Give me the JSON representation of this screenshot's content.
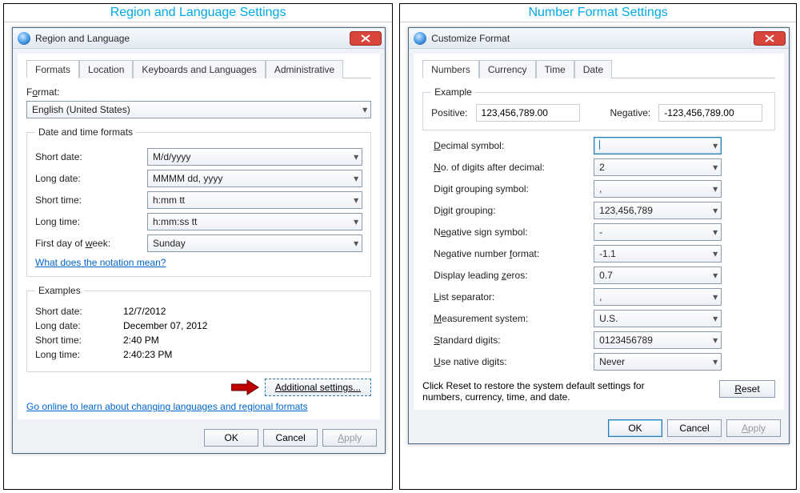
{
  "left": {
    "panel_title": "Region and Language Settings",
    "win_title": "Region and Language",
    "tabs": [
      "Formats",
      "Location",
      "Keyboards and Languages",
      "Administrative"
    ],
    "active_tab": 0,
    "format_label_pre": "F",
    "format_label_u": "o",
    "format_label_post": "rmat:",
    "format_value": "English (United States)",
    "group_dt_title": "Date and time formats",
    "rows": [
      {
        "label": "Short date:",
        "value": "M/d/yyyy"
      },
      {
        "label": "Long date:",
        "value": "MMMM dd, yyyy"
      },
      {
        "label": "Short time:",
        "value": "h:mm tt"
      },
      {
        "label": "Long time:",
        "value": "h:mm:ss tt"
      }
    ],
    "firstday_label_pre": "First day of ",
    "firstday_label_u": "w",
    "firstday_label_post": "eek:",
    "firstday_value": "Sunday",
    "notation_link": "What does the notation mean?",
    "examples_title": "Examples",
    "examples": [
      {
        "label": "Short date:",
        "value": "12/7/2012"
      },
      {
        "label": "Long date:",
        "value": "December 07, 2012"
      },
      {
        "label": "Short time:",
        "value": "2:40 PM"
      },
      {
        "label": "Long time:",
        "value": "2:40:23 PM"
      }
    ],
    "additional_u": "A",
    "additional_post": "dditional settings...",
    "online_link": "Go online to learn about changing languages and regional formats",
    "ok": "OK",
    "cancel": "Cancel",
    "apply_u": "A",
    "apply_post": "pply"
  },
  "right": {
    "panel_title": "Number Format Settings",
    "win_title": "Customize Format",
    "tabs": [
      "Numbers",
      "Currency",
      "Time",
      "Date"
    ],
    "active_tab": 0,
    "example_title": "Example",
    "positive_label": "Positive:",
    "positive_value": "123,456,789.00",
    "negative_label": "Negative:",
    "negative_value": "-123,456,789.00",
    "fields": [
      {
        "pre": "",
        "u": "D",
        "post": "ecimal symbol:",
        "value": "",
        "focused": true
      },
      {
        "pre": "",
        "u": "N",
        "post": "o. of digits after decimal:",
        "value": "2"
      },
      {
        "pre": "Digit grouping symbol:",
        "u": "",
        "post": "",
        "value": ","
      },
      {
        "pre": "D",
        "u": "i",
        "post": "git grouping:",
        "value": "123,456,789"
      },
      {
        "pre": "N",
        "u": "e",
        "post": "gative sign symbol:",
        "value": "-"
      },
      {
        "pre": "Negative number ",
        "u": "f",
        "post": "ormat:",
        "value": "-1.1"
      },
      {
        "pre": "Display leading ",
        "u": "z",
        "post": "eros:",
        "value": "0.7"
      },
      {
        "pre": "",
        "u": "L",
        "post": "ist separator:",
        "value": ","
      },
      {
        "pre": "",
        "u": "M",
        "post": "easurement system:",
        "value": "U.S."
      },
      {
        "pre": "",
        "u": "S",
        "post": "tandard digits:",
        "value": "0123456789"
      },
      {
        "pre": "",
        "u": "U",
        "post": "se native digits:",
        "value": "Never"
      }
    ],
    "reset_text": "Click Reset to restore the system default settings for numbers, currency, time, and date.",
    "reset_u": "R",
    "reset_post": "eset",
    "ok": "OK",
    "cancel": "Cancel",
    "apply_u": "A",
    "apply_post": "pply"
  }
}
